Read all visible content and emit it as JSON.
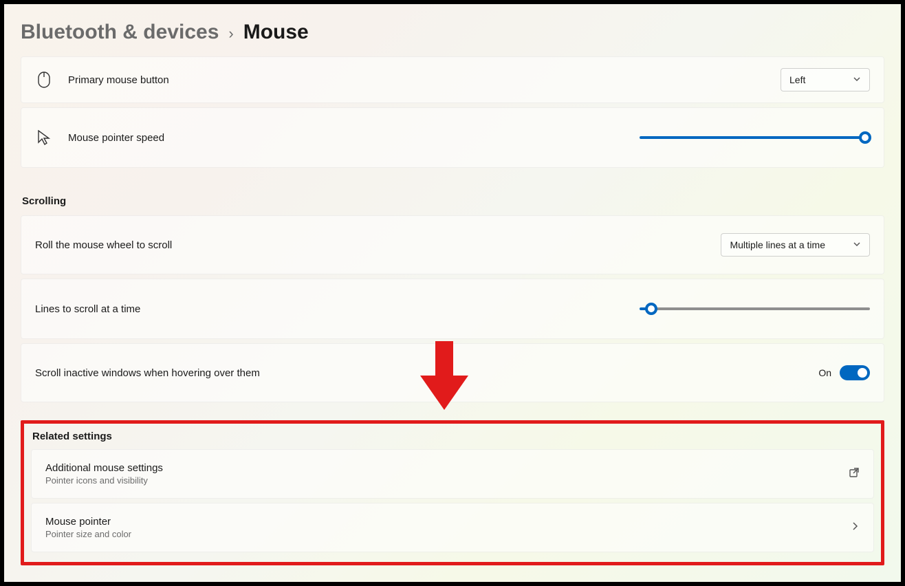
{
  "breadcrumb": {
    "parent": "Bluetooth & devices",
    "separator": "›",
    "current": "Mouse"
  },
  "primary_button": {
    "label": "Primary mouse button",
    "selected": "Left"
  },
  "pointer_speed": {
    "label": "Mouse pointer speed",
    "value_percent": 98
  },
  "scrolling": {
    "section_title": "Scrolling",
    "roll_label": "Roll the mouse wheel to scroll",
    "roll_selected": "Multiple lines at a time",
    "lines_label": "Lines to scroll at a time",
    "lines_value_percent": 5,
    "inactive_label": "Scroll inactive windows when hovering over them",
    "inactive_state_label": "On",
    "inactive_on": true
  },
  "related": {
    "section_title": "Related settings",
    "items": [
      {
        "title": "Additional mouse settings",
        "subtitle": "Pointer icons and visibility",
        "trail": "external"
      },
      {
        "title": "Mouse pointer",
        "subtitle": "Pointer size and color",
        "trail": "chevron"
      }
    ]
  },
  "annotations": {
    "arrow_color": "#e11b1b",
    "highlight_color": "#e11b1b"
  }
}
